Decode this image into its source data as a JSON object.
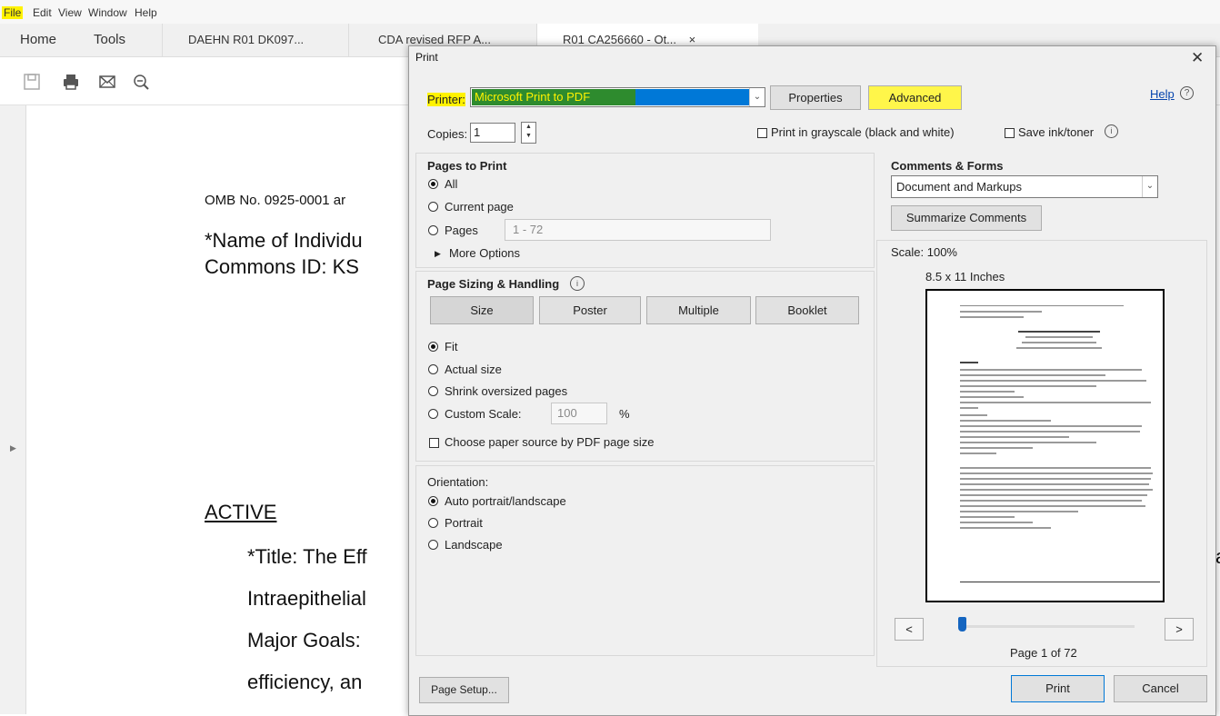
{
  "menu": [
    "File",
    "Edit",
    "View",
    "Window",
    "Help"
  ],
  "tabs": {
    "home": "Home",
    "tools": "Tools",
    "docs": [
      "DAEHN R01 DK097...",
      "CDA revised RFP A...",
      "R01 CA256660 - Ot..."
    ],
    "close_glyph": "×"
  },
  "document": {
    "omb_line": "OMB No. 0925-0001 ar",
    "name_line": "*Name of Individu",
    "commons_line": "Commons ID: KS",
    "active_heading": "ACTIVE",
    "title_line": "*Title: The Eff",
    "intra_line": "Intraepithelial",
    "goals_line": "Major Goals:",
    "efficiency_line": "efficiency, an",
    "cut_letter": "a"
  },
  "dialog": {
    "title": "Print",
    "close_glyph": "✕",
    "printer_label": "Printer:",
    "printer_value": "Microsoft Print to PDF",
    "properties_button": "Properties",
    "advanced_button": "Advanced",
    "help_link": "Help",
    "copies_label": "Copies:",
    "copies_value": "1",
    "grayscale_label": "Print in grayscale (black and white)",
    "save_ink_label": "Save ink/toner",
    "pages_to_print": {
      "heading": "Pages to Print",
      "all": "All",
      "current": "Current page",
      "pages": "Pages",
      "pages_range": "1 - 72",
      "more_options": "More Options"
    },
    "sizing": {
      "heading": "Page Sizing & Handling",
      "size_button": "Size",
      "poster_button": "Poster",
      "multiple_button": "Multiple",
      "booklet_button": "Booklet",
      "fit": "Fit",
      "actual": "Actual size",
      "shrink": "Shrink oversized pages",
      "custom": "Custom Scale:",
      "custom_value": "100",
      "percent": "%",
      "paper_source": "Choose paper source by PDF page size"
    },
    "orientation": {
      "heading": "Orientation:",
      "auto": "Auto portrait/landscape",
      "portrait": "Portrait",
      "landscape": "Landscape"
    },
    "comments": {
      "heading": "Comments & Forms",
      "value": "Document and Markups",
      "summarize_button": "Summarize Comments"
    },
    "preview": {
      "scale": "Scale: 100%",
      "paper": "8.5 x 11 Inches",
      "page_indicator": "Page 1 of 72",
      "prev": "<",
      "next": ">"
    },
    "page_setup_button": "Page Setup...",
    "print_button": "Print",
    "cancel_button": "Cancel"
  },
  "highlights": {
    "yellow": "#fff200",
    "printer_green": "#2e8b2e",
    "printer_blue": "#0078d7"
  }
}
